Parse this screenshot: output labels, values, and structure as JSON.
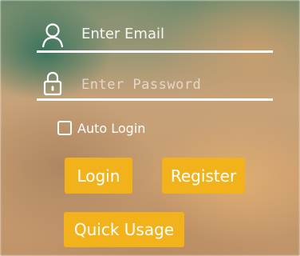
{
  "login_form": {
    "email": {
      "placeholder": "Enter Email",
      "value": "",
      "icon": "user-icon"
    },
    "password": {
      "placeholder": "Enter Password",
      "value": "",
      "icon": "lock-icon"
    },
    "auto_login": {
      "label": "Auto Login",
      "checked": false
    },
    "buttons": {
      "login": "Login",
      "register": "Register",
      "quick_usage": "Quick Usage"
    }
  },
  "colors": {
    "button": "#f2b21c",
    "text": "#ffffff"
  }
}
